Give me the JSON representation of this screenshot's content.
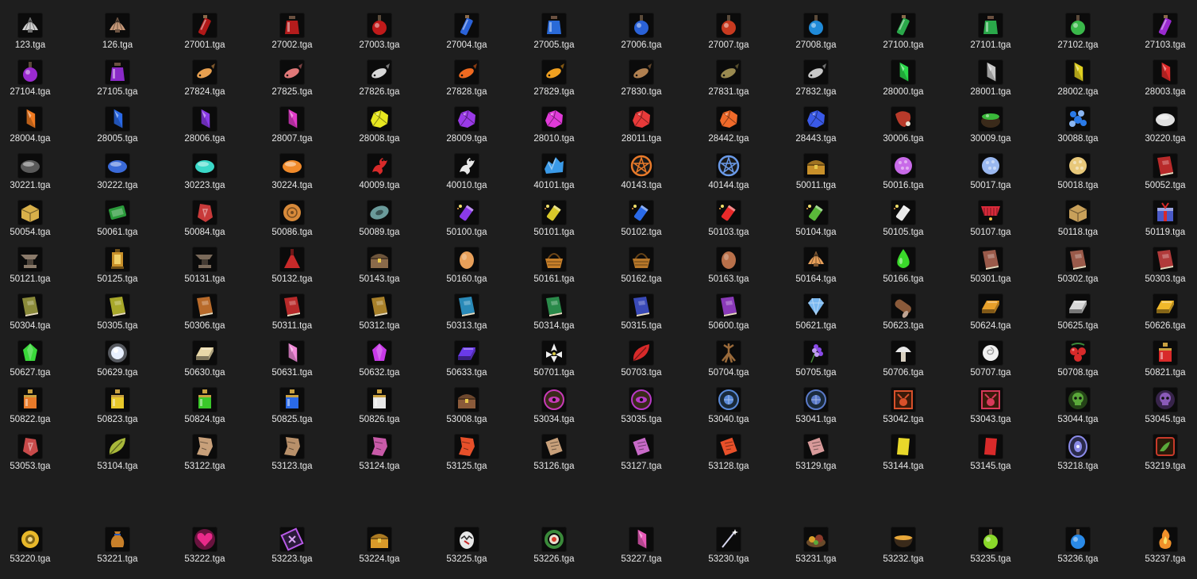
{
  "explorer": {
    "files": [
      {
        "name": "123.tga",
        "icon": "seashell-icon",
        "color": "#cfcfcf"
      },
      {
        "name": "126.tga",
        "icon": "seashell-icon",
        "color": "#c89a7a"
      },
      {
        "name": "27001.tga",
        "icon": "potion-vial-icon",
        "color": "#b01818"
      },
      {
        "name": "27002.tga",
        "icon": "potion-jar-icon",
        "color": "#b41c1c"
      },
      {
        "name": "27003.tga",
        "icon": "potion-flask-icon",
        "color": "#c01a1a"
      },
      {
        "name": "27004.tga",
        "icon": "potion-vial-icon",
        "color": "#2a62d8"
      },
      {
        "name": "27005.tga",
        "icon": "potion-jar-icon",
        "color": "#2a6ad8"
      },
      {
        "name": "27006.tga",
        "icon": "potion-flask-icon",
        "color": "#2a62d8"
      },
      {
        "name": "27007.tga",
        "icon": "potion-flask-icon",
        "color": "#c83a20"
      },
      {
        "name": "27008.tga",
        "icon": "potion-flask-icon",
        "color": "#1f8ad8"
      },
      {
        "name": "27100.tga",
        "icon": "potion-vial-icon",
        "color": "#2aa84a"
      },
      {
        "name": "27101.tga",
        "icon": "potion-jar-icon",
        "color": "#2aa84a"
      },
      {
        "name": "27102.tga",
        "icon": "potion-flask-icon",
        "color": "#3ab84a"
      },
      {
        "name": "27103.tga",
        "icon": "potion-vial-icon",
        "color": "#9a2ad0"
      },
      {
        "name": "27104.tga",
        "icon": "potion-flask-icon",
        "color": "#9a2ad0"
      },
      {
        "name": "27105.tga",
        "icon": "potion-jar-icon",
        "color": "#8a2ac8"
      },
      {
        "name": "27824.tga",
        "icon": "fish-icon",
        "color": "#e8a050"
      },
      {
        "name": "27825.tga",
        "icon": "fish-icon",
        "color": "#e07878"
      },
      {
        "name": "27826.tga",
        "icon": "fish-icon",
        "color": "#d8d8d8"
      },
      {
        "name": "27828.tga",
        "icon": "fish-icon",
        "color": "#f06a20"
      },
      {
        "name": "27829.tga",
        "icon": "fish-icon",
        "color": "#f0a020"
      },
      {
        "name": "27830.tga",
        "icon": "fish-icon",
        "color": "#b08050"
      },
      {
        "name": "27831.tga",
        "icon": "fish-icon",
        "color": "#9a8a50"
      },
      {
        "name": "27832.tga",
        "icon": "fish-icon",
        "color": "#c8c8c8"
      },
      {
        "name": "28000.tga",
        "icon": "crystal-icon",
        "color": "#2ad84a"
      },
      {
        "name": "28001.tga",
        "icon": "crystal-icon",
        "color": "#c8c8c8"
      },
      {
        "name": "28002.tga",
        "icon": "crystal-icon",
        "color": "#e0d020"
      },
      {
        "name": "28003.tga",
        "icon": "crystal-icon",
        "color": "#e02a2a"
      },
      {
        "name": "28004.tga",
        "icon": "crystal-icon",
        "color": "#f07a20"
      },
      {
        "name": "28005.tga",
        "icon": "crystal-icon",
        "color": "#2a6ae8"
      },
      {
        "name": "28006.tga",
        "icon": "crystal-icon",
        "color": "#8a3ae8"
      },
      {
        "name": "28007.tga",
        "icon": "crystal-icon",
        "color": "#e03ac8"
      },
      {
        "name": "28008.tga",
        "icon": "ore-icon",
        "color": "#e8e820"
      },
      {
        "name": "28009.tga",
        "icon": "ore-icon",
        "color": "#9a3ae8"
      },
      {
        "name": "28010.tga",
        "icon": "ore-icon",
        "color": "#e03ad8"
      },
      {
        "name": "28011.tga",
        "icon": "ore-icon",
        "color": "#e83a3a"
      },
      {
        "name": "28442.tga",
        "icon": "ore-icon",
        "color": "#f06a2a"
      },
      {
        "name": "28443.tga",
        "icon": "ore-icon",
        "color": "#3a5ae8"
      },
      {
        "name": "30006.tga",
        "icon": "meat-icon",
        "color": "#b83a2a"
      },
      {
        "name": "30009.tga",
        "icon": "cauldron-icon",
        "color": "#3ab83a"
      },
      {
        "name": "30088.tga",
        "icon": "gem-cluster-icon",
        "color": "#2a7ae8"
      },
      {
        "name": "30220.tga",
        "icon": "stone-icon",
        "color": "#e0e0e0"
      },
      {
        "name": "30221.tga",
        "icon": "stone-icon",
        "color": "#5a5a5a"
      },
      {
        "name": "30222.tga",
        "icon": "stone-icon",
        "color": "#3a6ad8"
      },
      {
        "name": "30223.tga",
        "icon": "stone-icon",
        "color": "#3ad8c8"
      },
      {
        "name": "30224.tga",
        "icon": "stone-icon",
        "color": "#f08a2a"
      },
      {
        "name": "40009.tga",
        "icon": "dragon-icon",
        "color": "#d82a2a"
      },
      {
        "name": "40010.tga",
        "icon": "dragon-icon",
        "color": "#e8e8e8"
      },
      {
        "name": "40101.tga",
        "icon": "ice-crystal-icon",
        "color": "#3a9ae8"
      },
      {
        "name": "40143.tga",
        "icon": "rune-circle-icon",
        "color": "#e87a2a"
      },
      {
        "name": "40144.tga",
        "icon": "rune-circle-icon",
        "color": "#6a9ae8"
      },
      {
        "name": "50011.tga",
        "icon": "treasure-chest-icon",
        "color": "#c8902a"
      },
      {
        "name": "50016.tga",
        "icon": "orb-icon",
        "color": "#c86ae8"
      },
      {
        "name": "50017.tga",
        "icon": "orb-icon",
        "color": "#9ab8f0"
      },
      {
        "name": "50018.tga",
        "icon": "orb-icon",
        "color": "#e8c87a"
      },
      {
        "name": "50052.tga",
        "icon": "book-icon",
        "color": "#b82a2a"
      },
      {
        "name": "50054.tga",
        "icon": "crate-icon",
        "color": "#d8b04a"
      },
      {
        "name": "50061.tga",
        "icon": "scroll-icon",
        "color": "#2a9a3a"
      },
      {
        "name": "50084.tga",
        "icon": "rune-stone-icon",
        "color": "#c83a3a"
      },
      {
        "name": "50086.tga",
        "icon": "mooncake-icon",
        "color": "#d88a3a"
      },
      {
        "name": "50089.tga",
        "icon": "gear-disk-icon",
        "color": "#6a9a9a"
      },
      {
        "name": "50100.tga",
        "icon": "firework-icon",
        "color": "#8a3ae8"
      },
      {
        "name": "50101.tga",
        "icon": "firework-icon",
        "color": "#d8c82a"
      },
      {
        "name": "50102.tga",
        "icon": "firework-icon",
        "color": "#2a6ae8"
      },
      {
        "name": "50103.tga",
        "icon": "firework-icon",
        "color": "#e82a2a"
      },
      {
        "name": "50104.tga",
        "icon": "firework-icon",
        "color": "#5ab83a"
      },
      {
        "name": "50105.tga",
        "icon": "firework-icon",
        "color": "#e8e8e8"
      },
      {
        "name": "50107.tga",
        "icon": "firecracker-icon",
        "color": "#d82a3a"
      },
      {
        "name": "50118.tga",
        "icon": "crate-icon",
        "color": "#c8a05a"
      },
      {
        "name": "50119.tga",
        "icon": "gift-box-icon",
        "color": "#4a5ac8"
      },
      {
        "name": "50121.tga",
        "icon": "anvil-icon",
        "color": "#8a7a6a"
      },
      {
        "name": "50125.tga",
        "icon": "lantern-icon",
        "color": "#c8902a"
      },
      {
        "name": "50131.tga",
        "icon": "anvil-icon",
        "color": "#7a6a5a"
      },
      {
        "name": "50132.tga",
        "icon": "flask-icon",
        "color": "#c82a2a"
      },
      {
        "name": "50143.tga",
        "icon": "treasure-chest-icon",
        "color": "#8a6a4a"
      },
      {
        "name": "50160.tga",
        "icon": "egg-icon",
        "color": "#e8a05a"
      },
      {
        "name": "50161.tga",
        "icon": "basket-icon",
        "color": "#c8802a"
      },
      {
        "name": "50162.tga",
        "icon": "basket-icon",
        "color": "#b8782a"
      },
      {
        "name": "50163.tga",
        "icon": "egg-icon",
        "color": "#b8704a"
      },
      {
        "name": "50164.tga",
        "icon": "seashell-icon",
        "color": "#e8a05a"
      },
      {
        "name": "50166.tga",
        "icon": "droplet-icon",
        "color": "#3ad82a"
      },
      {
        "name": "50301.tga",
        "icon": "book-icon",
        "color": "#9a5a4a"
      },
      {
        "name": "50302.tga",
        "icon": "book-icon",
        "color": "#9a5a4a"
      },
      {
        "name": "50303.tga",
        "icon": "book-icon",
        "color": "#b03a3a"
      },
      {
        "name": "50304.tga",
        "icon": "book-icon",
        "color": "#8a8a3a"
      },
      {
        "name": "50305.tga",
        "icon": "book-icon",
        "color": "#a8a82a"
      },
      {
        "name": "50306.tga",
        "icon": "book-icon",
        "color": "#b86a2a"
      },
      {
        "name": "50311.tga",
        "icon": "book-icon",
        "color": "#b82a2a"
      },
      {
        "name": "50312.tga",
        "icon": "book-icon",
        "color": "#a8802a"
      },
      {
        "name": "50313.tga",
        "icon": "book-icon",
        "color": "#2a8ab8"
      },
      {
        "name": "50314.tga",
        "icon": "book-icon",
        "color": "#2a8a4a"
      },
      {
        "name": "50315.tga",
        "icon": "book-icon",
        "color": "#3a4ab8"
      },
      {
        "name": "50600.tga",
        "icon": "book-icon",
        "color": "#8a3ab8"
      },
      {
        "name": "50621.tga",
        "icon": "diamond-icon",
        "color": "#7ab8f0"
      },
      {
        "name": "50623.tga",
        "icon": "log-icon",
        "color": "#8a5a3a"
      },
      {
        "name": "50624.tga",
        "icon": "ingot-icon",
        "color": "#e8a02a"
      },
      {
        "name": "50625.tga",
        "icon": "ingot-icon",
        "color": "#d8d8d8"
      },
      {
        "name": "50626.tga",
        "icon": "ingot-icon",
        "color": "#f0b82a"
      },
      {
        "name": "50627.tga",
        "icon": "gem-icon",
        "color": "#3ad83a"
      },
      {
        "name": "50629.tga",
        "icon": "glowing-orb-icon",
        "color": "#e8f0ff"
      },
      {
        "name": "50630.tga",
        "icon": "ingot-icon",
        "color": "#e8d8a8"
      },
      {
        "name": "50631.tga",
        "icon": "crystal-icon",
        "color": "#f08ad8"
      },
      {
        "name": "50632.tga",
        "icon": "gem-icon",
        "color": "#c83ae8"
      },
      {
        "name": "50633.tga",
        "icon": "ingot-icon",
        "color": "#6a3ae8"
      },
      {
        "name": "50701.tga",
        "icon": "flower-icon",
        "color": "#f0f0f0"
      },
      {
        "name": "50703.tga",
        "icon": "leaf-icon",
        "color": "#d82a2a"
      },
      {
        "name": "50704.tga",
        "icon": "root-icon",
        "color": "#9a6a3a"
      },
      {
        "name": "50705.tga",
        "icon": "lavender-icon",
        "color": "#8a4ae8"
      },
      {
        "name": "50706.tga",
        "icon": "mushroom-icon",
        "color": "#e8e8e8"
      },
      {
        "name": "50707.tga",
        "icon": "rose-icon",
        "color": "#f0f0f0"
      },
      {
        "name": "50708.tga",
        "icon": "berries-icon",
        "color": "#d82a2a"
      },
      {
        "name": "50821.tga",
        "icon": "potion-bottle-icon",
        "color": "#d82a2a"
      },
      {
        "name": "50822.tga",
        "icon": "potion-bottle-icon",
        "color": "#e87a2a"
      },
      {
        "name": "50823.tga",
        "icon": "potion-bottle-icon",
        "color": "#e8c82a"
      },
      {
        "name": "50824.tga",
        "icon": "potion-bottle-icon",
        "color": "#3ac82a"
      },
      {
        "name": "50825.tga",
        "icon": "potion-bottle-icon",
        "color": "#2a6ae8"
      },
      {
        "name": "50826.tga",
        "icon": "potion-bottle-icon",
        "color": "#e8e8e8"
      },
      {
        "name": "53008.tga",
        "icon": "treasure-chest-icon",
        "color": "#8a5a3a"
      },
      {
        "name": "53034.tga",
        "icon": "eye-emblem-icon",
        "color": "#c83ab8"
      },
      {
        "name": "53035.tga",
        "icon": "eye-emblem-icon",
        "color": "#b83ac8"
      },
      {
        "name": "53040.tga",
        "icon": "globe-emblem-icon",
        "color": "#5a8ad8"
      },
      {
        "name": "53041.tga",
        "icon": "globe-emblem-icon",
        "color": "#5a7ac8"
      },
      {
        "name": "53042.tga",
        "icon": "demon-emblem-icon",
        "color": "#d8502a"
      },
      {
        "name": "53043.tga",
        "icon": "demon-emblem-icon",
        "color": "#d83a5a"
      },
      {
        "name": "53044.tga",
        "icon": "skull-icon",
        "color": "#5aa83a"
      },
      {
        "name": "53045.tga",
        "icon": "skull-icon",
        "color": "#8a5ab8"
      },
      {
        "name": "53053.tga",
        "icon": "rune-stone-icon",
        "color": "#c84a4a"
      },
      {
        "name": "53104.tga",
        "icon": "leaf-icon",
        "color": "#a8b83a"
      },
      {
        "name": "53122.tga",
        "icon": "map-scrap-icon",
        "color": "#c8a07a"
      },
      {
        "name": "53123.tga",
        "icon": "map-scrap-icon",
        "color": "#b8906a"
      },
      {
        "name": "53124.tga",
        "icon": "map-scrap-icon",
        "color": "#c85aa8"
      },
      {
        "name": "53125.tga",
        "icon": "map-scrap-icon",
        "color": "#e8502a"
      },
      {
        "name": "53126.tga",
        "icon": "paper-icon",
        "color": "#c8a07a"
      },
      {
        "name": "53127.tga",
        "icon": "paper-icon",
        "color": "#c86ac8"
      },
      {
        "name": "53128.tga",
        "icon": "paper-icon",
        "color": "#e8502a"
      },
      {
        "name": "53129.tga",
        "icon": "paper-icon",
        "color": "#d89a9a"
      },
      {
        "name": "53144.tga",
        "icon": "card-icon",
        "color": "#e8d82a"
      },
      {
        "name": "53145.tga",
        "icon": "card-icon",
        "color": "#d82a2a"
      },
      {
        "name": "53218.tga",
        "icon": "eye-portal-icon",
        "color": "#8a8ae8"
      },
      {
        "name": "53219.tga",
        "icon": "dragon-emblem-icon",
        "color": "#c83a2a"
      },
      {
        "name": "53220.tga",
        "icon": "golden-emblem-icon",
        "color": "#e8b82a"
      },
      {
        "name": "53221.tga",
        "icon": "pouch-icon",
        "color": "#c8802a"
      },
      {
        "name": "53222.tga",
        "icon": "heart-icon",
        "color": "#e82a8a"
      },
      {
        "name": "53223.tga",
        "icon": "rune-tile-icon",
        "color": "#b85ae8"
      },
      {
        "name": "53224.tga",
        "icon": "treasure-chest-icon",
        "color": "#d89a2a"
      },
      {
        "name": "53225.tga",
        "icon": "cracked-egg-icon",
        "color": "#e8e8e8"
      },
      {
        "name": "53226.tga",
        "icon": "wreath-icon",
        "color": "#d83a2a"
      },
      {
        "name": "53227.tga",
        "icon": "crystal-icon",
        "color": "#e85ab8"
      },
      {
        "name": "53230.tga",
        "icon": "wand-icon",
        "color": "#d8d8f0"
      },
      {
        "name": "53231.tga",
        "icon": "food-plate-icon",
        "color": "#d8a02a"
      },
      {
        "name": "53232.tga",
        "icon": "soup-bowl-icon",
        "color": "#e8a83a"
      },
      {
        "name": "53235.tga",
        "icon": "potion-flask-icon",
        "color": "#8ad82a"
      },
      {
        "name": "53236.tga",
        "icon": "potion-flask-icon",
        "color": "#2a8ae8"
      },
      {
        "name": "53237.tga",
        "icon": "fire-flask-icon",
        "color": "#f0902a"
      }
    ]
  }
}
